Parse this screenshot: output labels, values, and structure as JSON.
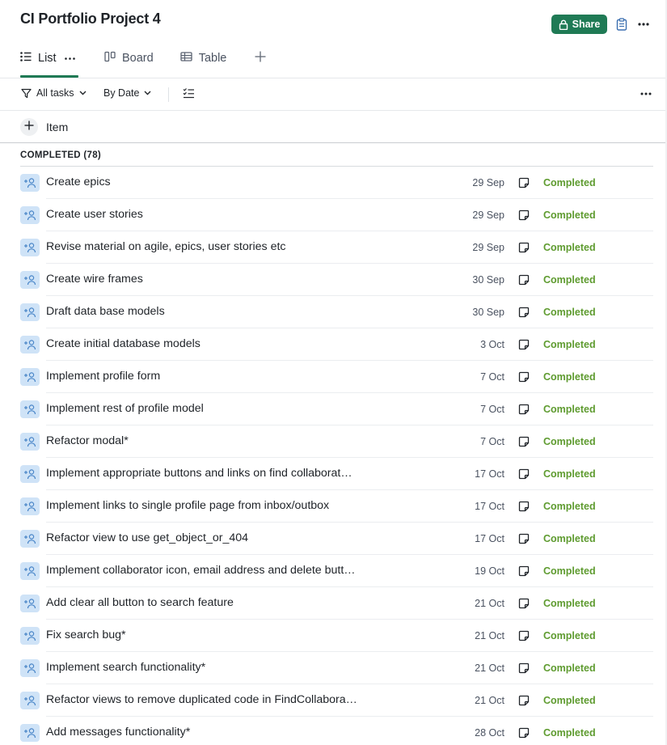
{
  "project": {
    "title": "CI Portfolio Project 4"
  },
  "header_actions": {
    "share_label": "Share",
    "share_color": "#1f7a55",
    "icons": [
      "lock-icon",
      "clipboard-icon",
      "more-horizontal-icon"
    ]
  },
  "tabs": [
    {
      "label": "List",
      "icon": "list-icon",
      "active": true
    },
    {
      "label": "Board",
      "icon": "board-icon",
      "active": false
    },
    {
      "label": "Table",
      "icon": "table-icon",
      "active": false
    }
  ],
  "filters": {
    "tasks_filter": "All tasks",
    "grouping": "By Date",
    "icons": [
      "filter-icon",
      "chevron-down-icon",
      "checklist-icon",
      "more-horizontal-icon"
    ]
  },
  "add_item": {
    "label": "Item",
    "icon": "plus-icon"
  },
  "section": {
    "title": "COMPLETED (78)",
    "status_color": "#5e9b2f",
    "tasks": [
      {
        "name": "Create epics",
        "date": "29 Sep",
        "status": "Completed"
      },
      {
        "name": "Create user stories",
        "date": "29 Sep",
        "status": "Completed"
      },
      {
        "name": "Revise material on agile, epics, user stories etc",
        "date": "29 Sep",
        "status": "Completed"
      },
      {
        "name": "Create wire frames",
        "date": "30 Sep",
        "status": "Completed"
      },
      {
        "name": "Draft data base models",
        "date": "30 Sep",
        "status": "Completed"
      },
      {
        "name": "Create initial database models",
        "date": "3 Oct",
        "status": "Completed"
      },
      {
        "name": "Implement profile form",
        "date": "7 Oct",
        "status": "Completed"
      },
      {
        "name": "Implement rest of profile model",
        "date": "7 Oct",
        "status": "Completed"
      },
      {
        "name": "Refactor modal*",
        "date": "7 Oct",
        "status": "Completed"
      },
      {
        "name": "Implement appropriate buttons and links on find collaborat…",
        "date": "17 Oct",
        "status": "Completed"
      },
      {
        "name": "Implement links to single profile page from inbox/outbox",
        "date": "17 Oct",
        "status": "Completed"
      },
      {
        "name": "Refactor view to use get_object_or_404",
        "date": "17 Oct",
        "status": "Completed"
      },
      {
        "name": "Implement collaborator icon, email address and delete butt…",
        "date": "19 Oct",
        "status": "Completed"
      },
      {
        "name": "Add clear all button to search feature",
        "date": "21 Oct",
        "status": "Completed"
      },
      {
        "name": "Fix search bug*",
        "date": "21 Oct",
        "status": "Completed"
      },
      {
        "name": "Implement search functionality*",
        "date": "21 Oct",
        "status": "Completed"
      },
      {
        "name": "Refactor views to remove duplicated code in FindCollabora…",
        "date": "21 Oct",
        "status": "Completed"
      },
      {
        "name": "Add messages functionality*",
        "date": "28 Oct",
        "status": "Completed"
      }
    ]
  }
}
